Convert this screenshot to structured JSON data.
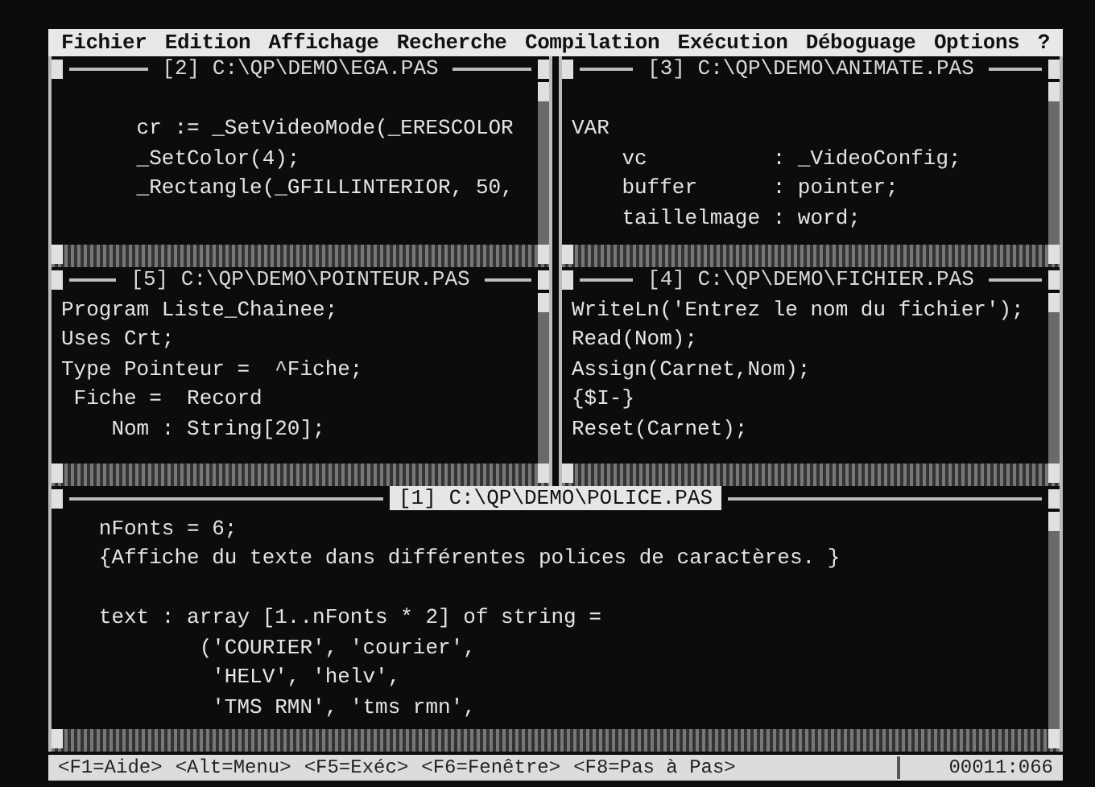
{
  "menu": [
    "Fichier",
    "Edition",
    "Affichage",
    "Recherche",
    "Compilation",
    "Exécution",
    "Déboguage",
    "Options",
    "?"
  ],
  "windows": [
    {
      "title": "[2] C:\\QP\\DEMO\\EGA.PAS",
      "active": false,
      "lines": [
        {
          "text": "      cr := _SetVideoMode(_ERESCOLOR",
          "blank_before": true
        },
        "      _SetColor(4);",
        "      _Rectangle(_GFILLINTERIOR, 50,"
      ]
    },
    {
      "title": "[3] C:\\QP\\DEMO\\ANIMATE.PAS",
      "active": false,
      "lines": [
        {
          "text": "VAR",
          "blank_before": true
        },
        "    vc          : _VideoConfig;",
        "    buffer      : pointer;",
        "    taillelmage : word;"
      ]
    },
    {
      "title": "[5] C:\\QP\\DEMO\\POINTEUR.PAS",
      "active": false,
      "lines": [
        "Program Liste_Chainee;",
        "Uses Crt;",
        "Type Pointeur =  ^Fiche;",
        " Fiche =  Record",
        "    Nom : String[20];"
      ]
    },
    {
      "title": "[4] C:\\QP\\DEMO\\FICHIER.PAS",
      "active": false,
      "lines": [
        "WriteLn('Entrez le nom du fichier');",
        "Read(Nom);",
        "Assign(Carnet,Nom);",
        "{$I-}",
        "Reset(Carnet);"
      ]
    },
    {
      "title": "[1] C:\\QP\\DEMO\\POLICE.PAS",
      "active": true,
      "lines": [
        "   nFonts = 6;",
        "   {Affiche du texte dans différentes polices de caractères. }",
        {
          "text": "   text : array [1..nFonts * 2] of string =",
          "blank_before": true
        },
        "           ('COURIER', 'courier',",
        "            'HELV', 'helv',",
        "            'TMS RMN', 'tms rmn',"
      ]
    }
  ],
  "status_bar": {
    "keys": [
      "<F1=Aide>",
      "<Alt=Menu>",
      "<F5=Exéc>",
      "<F6=Fenêtre>",
      "<F8=Pas à Pas>"
    ],
    "position": "00011:066"
  }
}
